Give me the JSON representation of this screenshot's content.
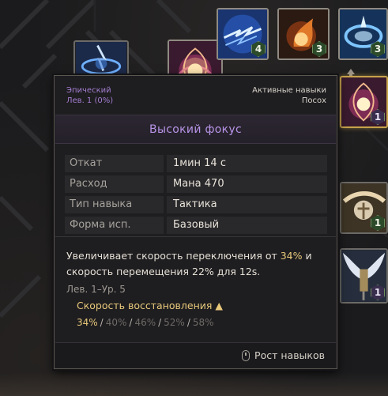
{
  "tooltip": {
    "rarity": "Эпический",
    "level": "Лев. 1 (0%)",
    "category": "Активные навыки",
    "weapon": "Посох",
    "title": "Высокий фокус",
    "stats": [
      {
        "label": "Откат",
        "value": "1мин 14 с"
      },
      {
        "label": "Расход",
        "value": "Мана  470"
      },
      {
        "label": "Тип навыка",
        "value": "Тактика"
      },
      {
        "label": "Форма исп.",
        "value": "Базовый"
      }
    ],
    "description": {
      "part1": "Увеличивает скорость переключения от ",
      "highlight": "34%",
      "part2": " и скорость перемещения 22% для 12s."
    },
    "level_range": "Лев. 1–Ур. 5",
    "cooldown_label": "Скорость восстановления ▲",
    "cooldown_values": [
      "34%",
      "40%",
      "46%",
      "52%",
      "58%"
    ],
    "footer_button": "Рост навыков"
  },
  "skill_slots": [
    {
      "name": "lightning-skill",
      "level": "4"
    },
    {
      "name": "fire-fist-skill",
      "level": "3"
    },
    {
      "name": "ice-vortex-skill",
      "level": "3"
    },
    {
      "name": "high-focus-skill",
      "level": "1"
    },
    {
      "name": "high-focus-skill-selected",
      "level": "1"
    },
    {
      "name": "holy-cross-skill",
      "level": "1"
    },
    {
      "name": "winged-guardian-skill",
      "level": "1"
    }
  ],
  "colors": {
    "rarity_epic": "#a37ecf",
    "title": "#b793e6",
    "highlight": "#e8c97a",
    "selected_border": "#c7a24b"
  }
}
